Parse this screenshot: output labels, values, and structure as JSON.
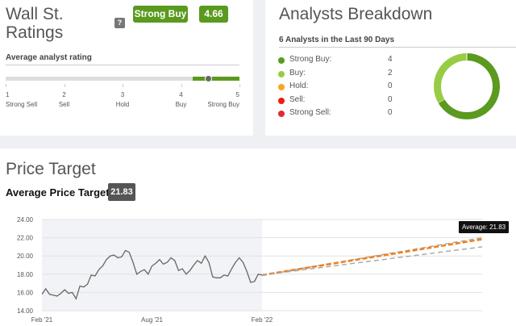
{
  "ratings": {
    "title_line1": "Wall St.",
    "title_line2": "Ratings",
    "help": "?",
    "badge_label": "Strong Buy",
    "badge_score": "4.66",
    "score_value": 4.66,
    "subtitle": "Average analyst rating",
    "scale": [
      {
        "num": "1",
        "label": "Strong Sell"
      },
      {
        "num": "2",
        "label": "Sell"
      },
      {
        "num": "3",
        "label": "Hold"
      },
      {
        "num": "4",
        "label": "Buy"
      },
      {
        "num": "5",
        "label": "Strong Buy"
      }
    ],
    "accent": "#5a9a1e"
  },
  "breakdown": {
    "title": "Analysts Breakdown",
    "subtitle": "6 Analysts in the Last 90 Days",
    "items": [
      {
        "label": "Strong Buy:",
        "count": "4",
        "value": 4,
        "color": "#5a9a1e"
      },
      {
        "label": "Buy:",
        "count": "2",
        "value": 2,
        "color": "#98cc45"
      },
      {
        "label": "Hold:",
        "count": "0",
        "value": 0,
        "color": "#f5a623"
      },
      {
        "label": "Sell:",
        "count": "0",
        "value": 0,
        "color": "#f21a0f"
      },
      {
        "label": "Strong Sell:",
        "count": "0",
        "value": 0,
        "color": "#e02b35"
      }
    ]
  },
  "price_target": {
    "title": "Price Target",
    "avg_label": "Average Price Target",
    "avg_value": "21.83",
    "tooltip": "Average: 21.83"
  },
  "chart_data": {
    "type": "line",
    "ylim": [
      14,
      24
    ],
    "yticks": [
      "24.00",
      "22.00",
      "20.00",
      "18.00",
      "16.00",
      "14.00"
    ],
    "ytick_values": [
      24,
      22,
      20,
      18,
      16,
      14
    ],
    "xticks": [
      "Feb '21",
      "Aug '21",
      "Feb '22"
    ],
    "history": [
      15.8,
      16.4,
      15.8,
      15.7,
      15.6,
      15.9,
      16.3,
      15.9,
      16.0,
      15.3,
      16.7,
      16.6,
      16.9,
      17.9,
      17.8,
      18.5,
      18.9,
      19.6,
      20.0,
      20.1,
      19.8,
      19.9,
      20.6,
      20.4,
      19.3,
      18.0,
      18.3,
      18.5,
      18.0,
      18.9,
      19.2,
      19.6,
      19.1,
      19.3,
      19.8,
      19.5,
      18.4,
      18.6,
      18.0,
      18.4,
      19.0,
      19.5,
      19.2,
      20.0,
      19.3,
      17.7,
      17.6,
      17.6,
      17.9,
      17.8,
      18.6,
      19.3,
      19.8,
      19.3,
      18.3,
      17.1,
      17.2,
      18.0,
      17.9
    ],
    "projections": [
      {
        "name": "High",
        "start": 17.9,
        "end": 22.0,
        "color": "#aaaaaa"
      },
      {
        "name": "Average",
        "start": 17.9,
        "end": 21.83,
        "color": "#f07f1a"
      },
      {
        "name": "Low",
        "start": 17.9,
        "end": 21.0,
        "color": "#aaaaaa"
      }
    ]
  }
}
